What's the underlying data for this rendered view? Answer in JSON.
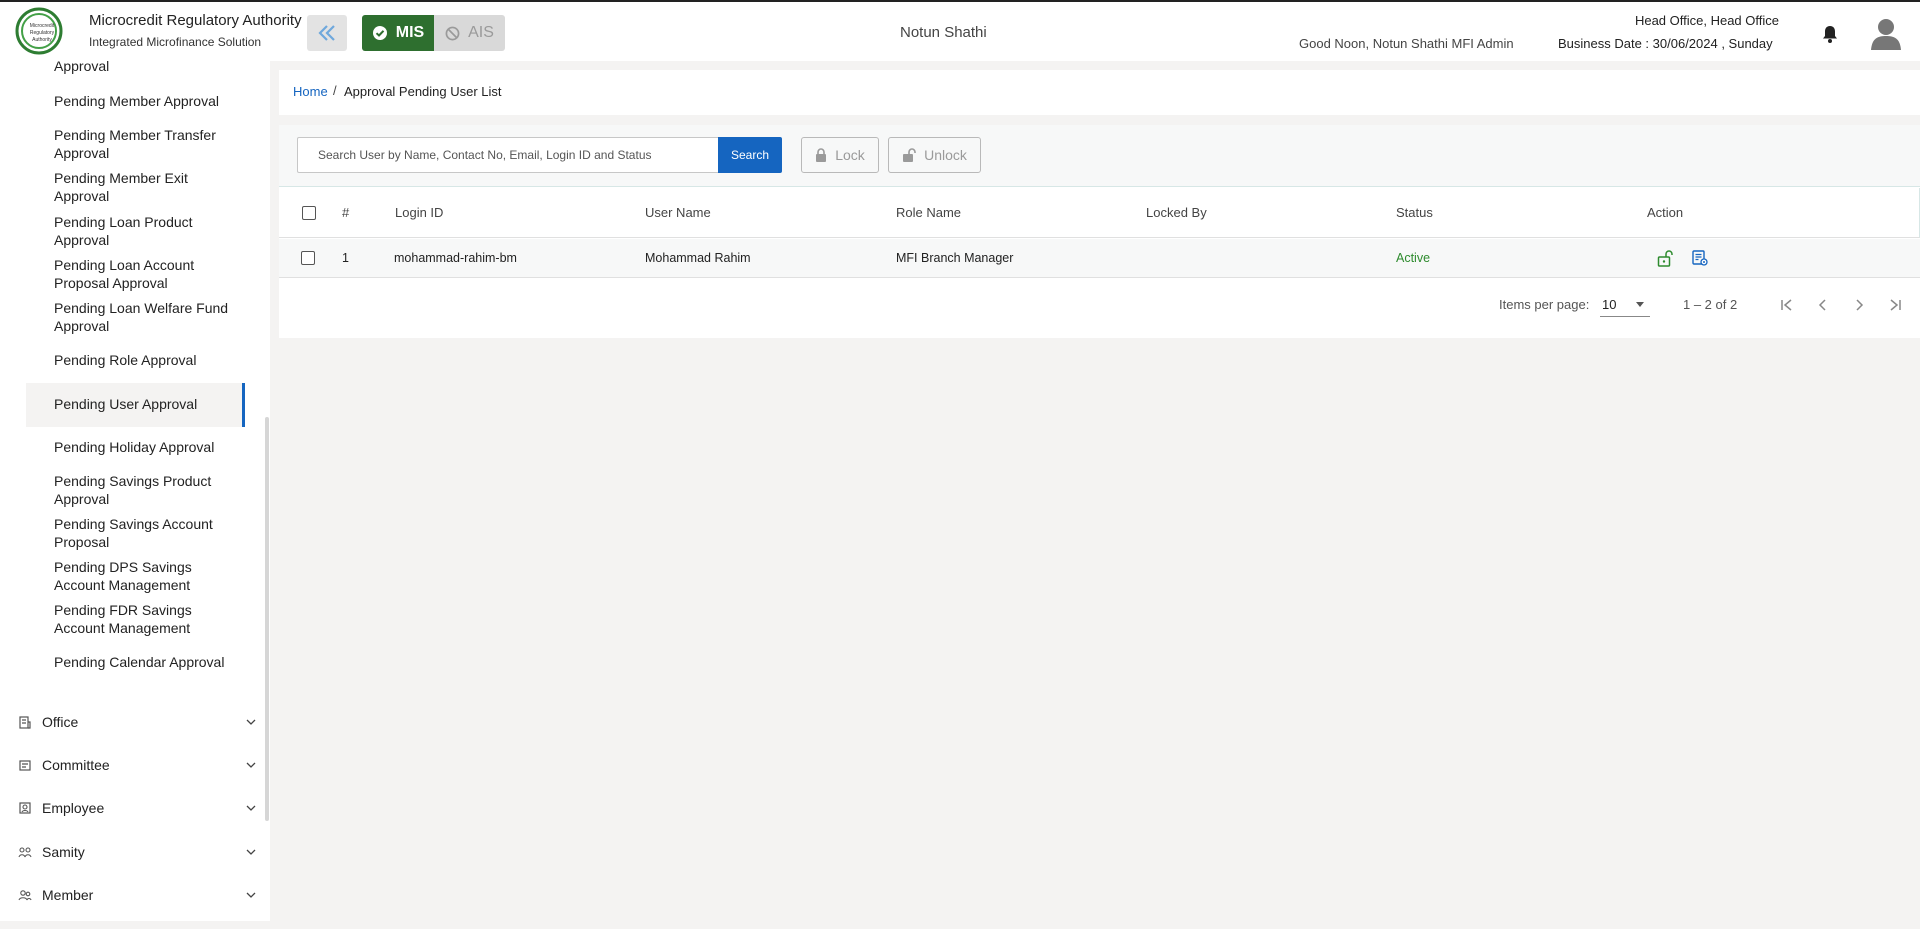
{
  "header": {
    "brand_title": "Microcredit Regulatory Authority",
    "brand_subtitle": "Integrated Microfinance Solution",
    "logo_text": "Microcredit Regulatory Authority",
    "mode_mis": "MIS",
    "mode_ais": "AIS",
    "org_name": "Notun Shathi",
    "greeting": "Good Noon, Notun Shathi MFI Admin",
    "office": "Head Office, Head Office",
    "business_date": "Business Date : 30/06/2024 , Sunday"
  },
  "sidebar": {
    "sub_items": [
      {
        "label": "Approval"
      },
      {
        "label": "Pending Member Approval"
      },
      {
        "label": "Pending Member Transfer Approval"
      },
      {
        "label": "Pending Member Exit Approval"
      },
      {
        "label": "Pending Loan Product Approval"
      },
      {
        "label": "Pending Loan Account Proposal Approval"
      },
      {
        "label": "Pending Loan Welfare Fund Approval"
      },
      {
        "label": "Pending Role Approval"
      },
      {
        "label": "Pending User Approval"
      },
      {
        "label": "Pending Holiday Approval"
      },
      {
        "label": "Pending Savings Product Approval"
      },
      {
        "label": "Pending Savings Account Proposal"
      },
      {
        "label": "Pending DPS Savings Account Management"
      },
      {
        "label": "Pending FDR Savings Account Management"
      },
      {
        "label": "Pending Calendar Approval"
      }
    ],
    "active_item": "Pending User Approval",
    "sections": [
      {
        "label": "Office",
        "icon": "office-icon"
      },
      {
        "label": "Committee",
        "icon": "committee-icon"
      },
      {
        "label": "Employee",
        "icon": "employee-icon"
      },
      {
        "label": "Samity",
        "icon": "samity-icon"
      },
      {
        "label": "Member",
        "icon": "member-icon"
      }
    ]
  },
  "breadcrumb": {
    "home": "Home",
    "separator": "/",
    "current": "Approval Pending User List"
  },
  "toolbar": {
    "search_placeholder": "Search User by Name, Contact No, Email, Login ID and Status",
    "search_label": "Search",
    "lock_label": "Lock",
    "unlock_label": "Unlock"
  },
  "table": {
    "columns": [
      "#",
      "Login ID",
      "User Name",
      "Role Name",
      "Locked By",
      "Status",
      "Action"
    ],
    "rows": [
      {
        "index": "1",
        "login_id": "mohammad-rahim-bm",
        "user_name": "Mohammad Rahim",
        "role_name": "MFI Branch Manager",
        "locked_by": "",
        "status": "Active"
      }
    ]
  },
  "paginator": {
    "items_per_page_label": "Items per page:",
    "items_per_page": "10",
    "range": "1 – 2 of 2"
  },
  "colors": {
    "primary": "#1565c0",
    "mis_green": "#2e6f2f",
    "status_active": "#2e8b2e"
  }
}
